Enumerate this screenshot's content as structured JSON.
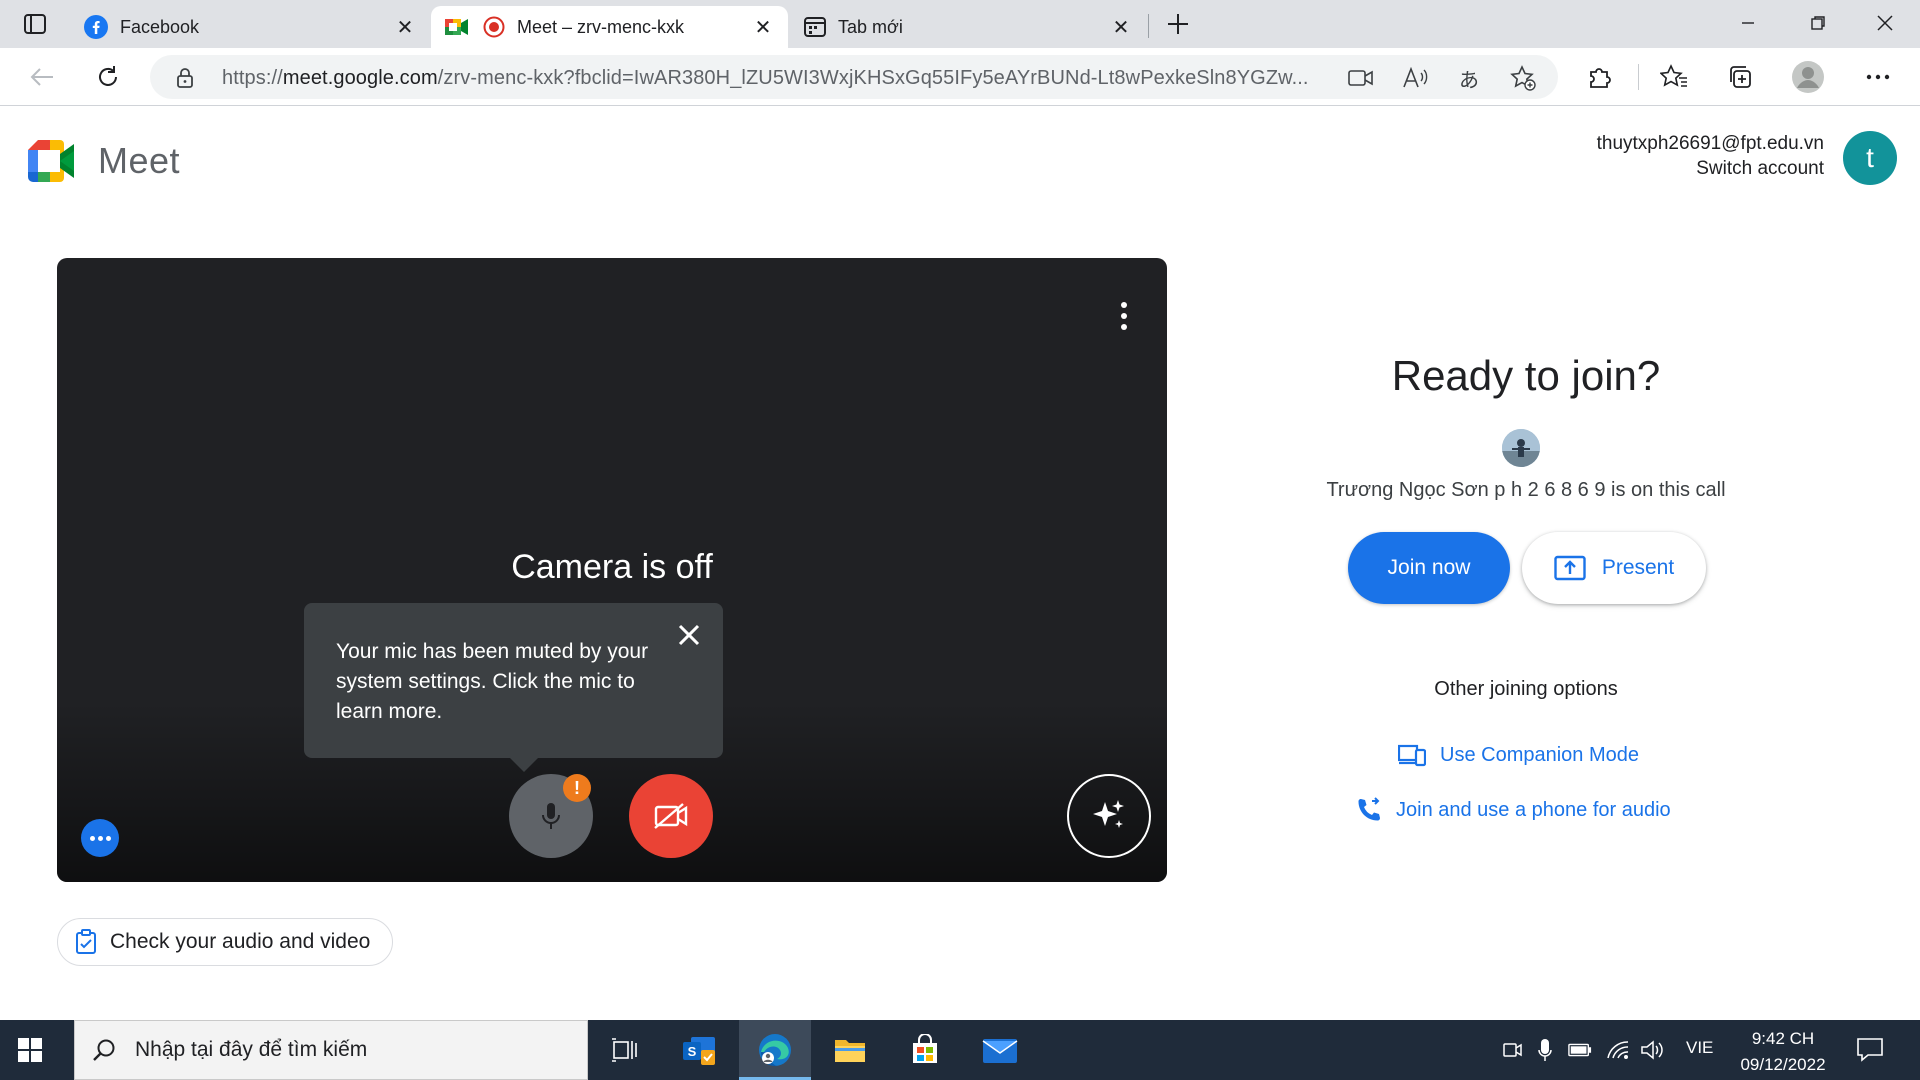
{
  "browser": {
    "tabs": [
      {
        "title": "Facebook"
      },
      {
        "title": "Meet – zrv-menc-kxk"
      },
      {
        "title": "Tab mới"
      }
    ],
    "url_prefix": "https://",
    "url_host": "meet.google.com",
    "url_rest": "/zrv-menc-kxk?fbclid=IwAR380H_lZU5WI3WxjKHSxGq55IFy5eAYrBUNd-Lt8wPexkeSln8YGZw..."
  },
  "meet": {
    "logo_text": "Meet",
    "account_email": "thuytxph26691@fpt.edu.vn",
    "switch_account": "Switch account",
    "avatar_letter": "t"
  },
  "preview": {
    "camera_off": "Camera is off",
    "tooltip": "Your mic has been muted by your system settings. Click the mic to learn more.",
    "mic_warning": "!",
    "check_audio_video": "Check your audio and video"
  },
  "join_panel": {
    "heading": "Ready to join?",
    "on_call": "Trương Ngọc Sơn p h 2 6 8 6 9 is on this call",
    "join_now": "Join now",
    "present": "Present",
    "other_options": "Other joining options",
    "companion_mode": "Use Companion Mode",
    "phone_audio": "Join and use a phone for audio"
  },
  "taskbar": {
    "search_placeholder": "Nhập tại đây để tìm kiếm",
    "language": "VIE",
    "time": "9:42 CH",
    "date": "09/12/2022"
  },
  "colors": {
    "accent": "#1a73e8",
    "danger": "#ea4335",
    "warning": "#ee7b1d",
    "preview_bg": "#202124",
    "taskbar_bg": "#1f2b3a"
  }
}
